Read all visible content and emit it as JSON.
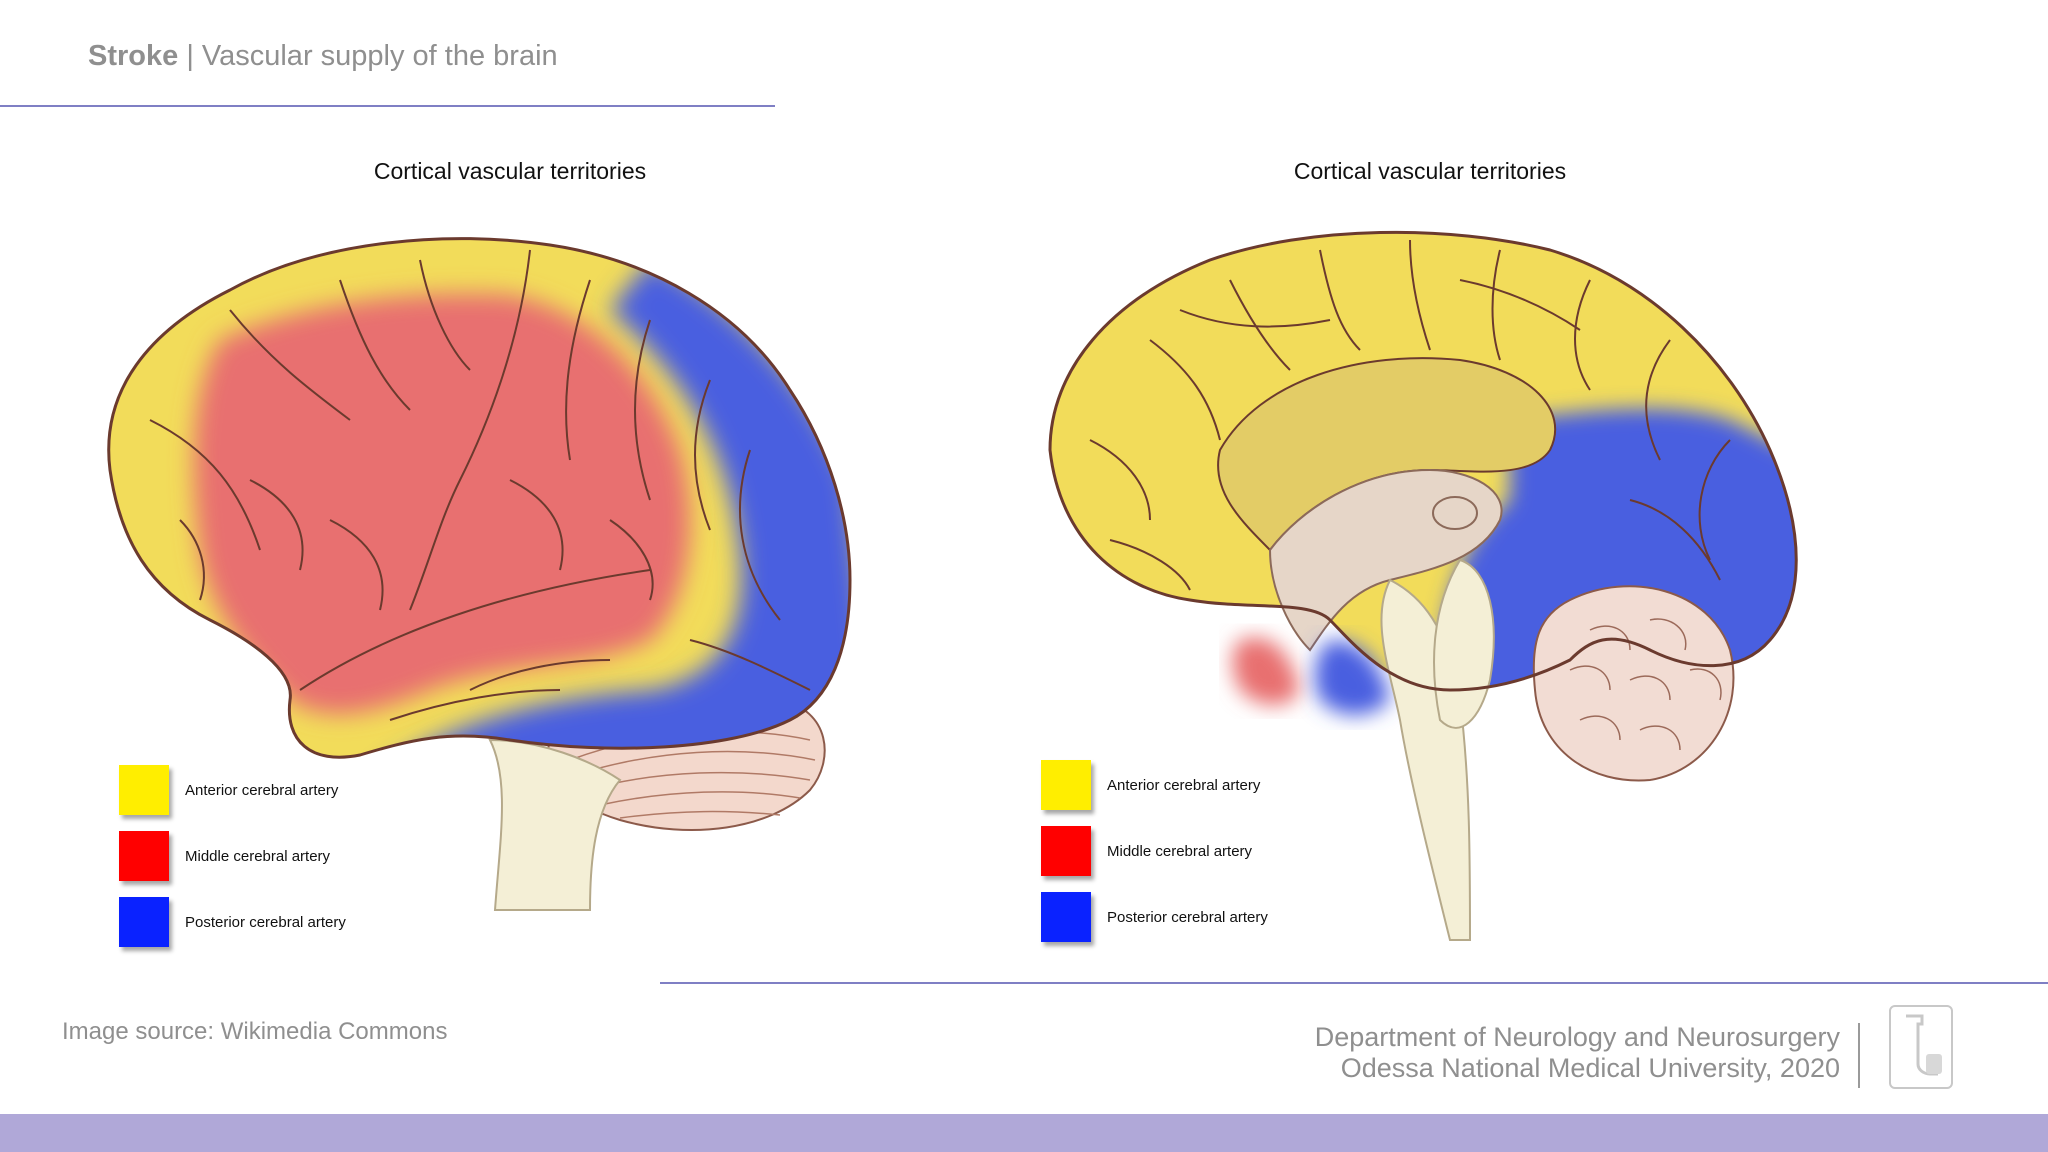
{
  "header": {
    "title_bold": "Stroke",
    "separator": " | ",
    "title_rest": "Vascular supply of the brain"
  },
  "left_panel": {
    "title": "Cortical vascular territories",
    "legend": [
      {
        "label": "Anterior cerebral artery",
        "color": "#ffee00"
      },
      {
        "label": "Middle cerebral artery",
        "color": "#ff0000"
      },
      {
        "label": "Posterior cerebral artery",
        "color": "#0a22ff"
      }
    ]
  },
  "right_panel": {
    "title": "Cortical vascular territories",
    "legend": [
      {
        "label": "Anterior cerebral artery",
        "color": "#ffee00"
      },
      {
        "label": "Middle cerebral artery",
        "color": "#ff0000"
      },
      {
        "label": "Posterior cerebral artery",
        "color": "#0a22ff"
      }
    ]
  },
  "territory_colors": {
    "anterior": "#f2dc5a",
    "middle": "#e87070",
    "posterior": "#4a5fe0"
  },
  "source": "Image source: Wikimedia Commons",
  "footer": {
    "department": "Department of Neurology and Neurosurgery",
    "university": "Odessa National Medical University, 2020"
  },
  "theme": {
    "accent": "#7f7fc4",
    "band": "#b0a8d8"
  }
}
